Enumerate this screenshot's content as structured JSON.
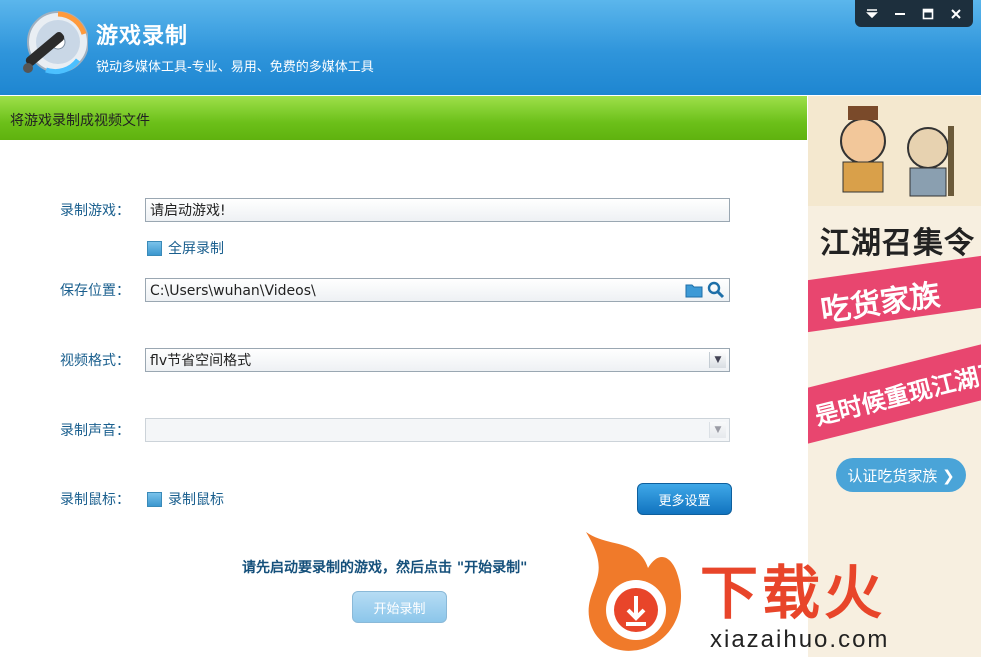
{
  "app": {
    "title": "游戏录制",
    "subtitle": "锐动多媒体工具-专业、易用、免费的多媒体工具"
  },
  "window_controls": [
    "menu-icon",
    "minimize-icon",
    "maximize-icon",
    "close-icon"
  ],
  "section": {
    "title": "将游戏录制成视频文件"
  },
  "form": {
    "game_label": "录制游戏：",
    "game_value": "请启动游戏!",
    "fullscreen_label": "全屏录制",
    "save_label": "保存位置：",
    "save_value": "C:\\Users\\wuhan\\Videos\\",
    "format_label": "视频格式：",
    "format_value": "flv节省空间格式",
    "audio_label": "录制声音：",
    "audio_value": "",
    "mouse_label": "录制鼠标：",
    "mouse_check_label": "录制鼠标",
    "more_settings": "更多设置"
  },
  "hint": "请先启动要录制的游戏，然后点击 \"开始录制\"",
  "start_button": "开始录制",
  "ad": {
    "line1": "江湖召集令",
    "line2": "吃货家族",
    "line3": "是时候重现江湖了",
    "button": "认证吃货家族 ❯"
  },
  "watermark": {
    "text": "下载火",
    "url": "xiazaihuo.com"
  },
  "colors": {
    "header": "#2f95db",
    "section_bar": "#6cc01a",
    "label": "#1a5f8e",
    "accent_button": "#1173bf"
  }
}
